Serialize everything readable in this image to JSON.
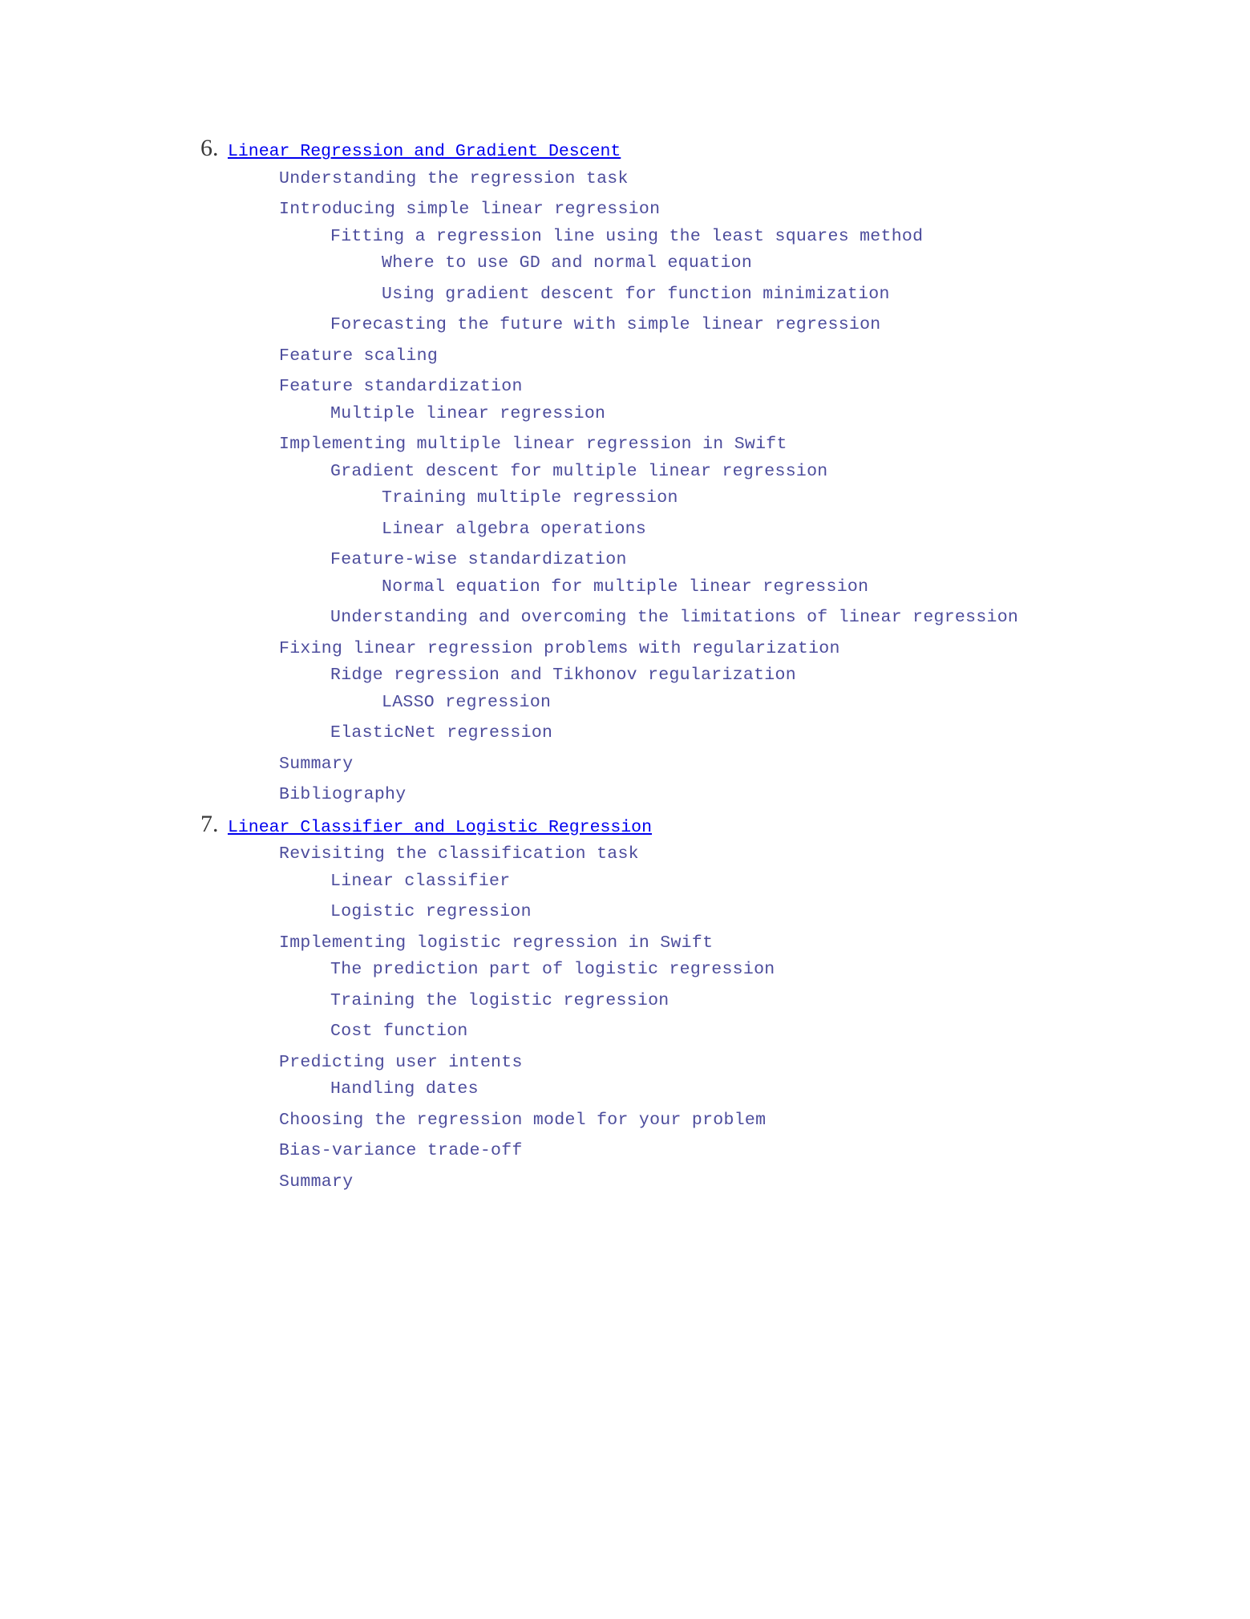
{
  "link_color": "#4c4c9c",
  "chapters": [
    {
      "number": 6,
      "title": "Linear Regression and Gradient Descent",
      "children": [
        {
          "title": "Understanding the regression task"
        },
        {
          "title": "Introducing simple linear regression",
          "children": [
            {
              "title": "Fitting a regression line using the least squares method",
              "children": [
                {
                  "title": "Where to use GD and normal equation"
                },
                {
                  "title": "Using gradient descent for function minimization"
                }
              ]
            },
            {
              "title": "Forecasting the future with simple linear regression"
            }
          ]
        },
        {
          "title": "Feature scaling"
        },
        {
          "title": "Feature standardization",
          "children": [
            {
              "title": "Multiple linear regression"
            }
          ]
        },
        {
          "title": "Implementing multiple linear regression in Swift",
          "children": [
            {
              "title": "Gradient descent for multiple linear regression",
              "children": [
                {
                  "title": "Training multiple regression"
                },
                {
                  "title": "Linear algebra operations"
                }
              ]
            },
            {
              "title": "Feature-wise standardization",
              "children": [
                {
                  "title": "Normal equation for multiple linear regression"
                }
              ]
            },
            {
              "title": "Understanding and overcoming the limitations of linear regression"
            }
          ]
        },
        {
          "title": "Fixing linear regression problems with regularization",
          "children": [
            {
              "title": "Ridge regression and Tikhonov regularization",
              "children": [
                {
                  "title": "LASSO regression"
                }
              ]
            },
            {
              "title": "ElasticNet regression"
            }
          ]
        },
        {
          "title": "Summary"
        },
        {
          "title": "Bibliography"
        }
      ]
    },
    {
      "number": 7,
      "title": "Linear Classifier and Logistic Regression",
      "children": [
        {
          "title": "Revisiting the classification task",
          "children": [
            {
              "title": "Linear classifier"
            },
            {
              "title": "Logistic regression"
            }
          ]
        },
        {
          "title": "Implementing logistic regression in Swift",
          "children": [
            {
              "title": "The prediction part of logistic regression"
            },
            {
              "title": "Training the logistic regression"
            },
            {
              "title": "Cost function"
            }
          ]
        },
        {
          "title": "Predicting user intents",
          "children": [
            {
              "title": "Handling dates"
            }
          ]
        },
        {
          "title": "Choosing the regression model for your problem"
        },
        {
          "title": "Bias-variance trade-off"
        },
        {
          "title": "Summary"
        }
      ]
    }
  ]
}
